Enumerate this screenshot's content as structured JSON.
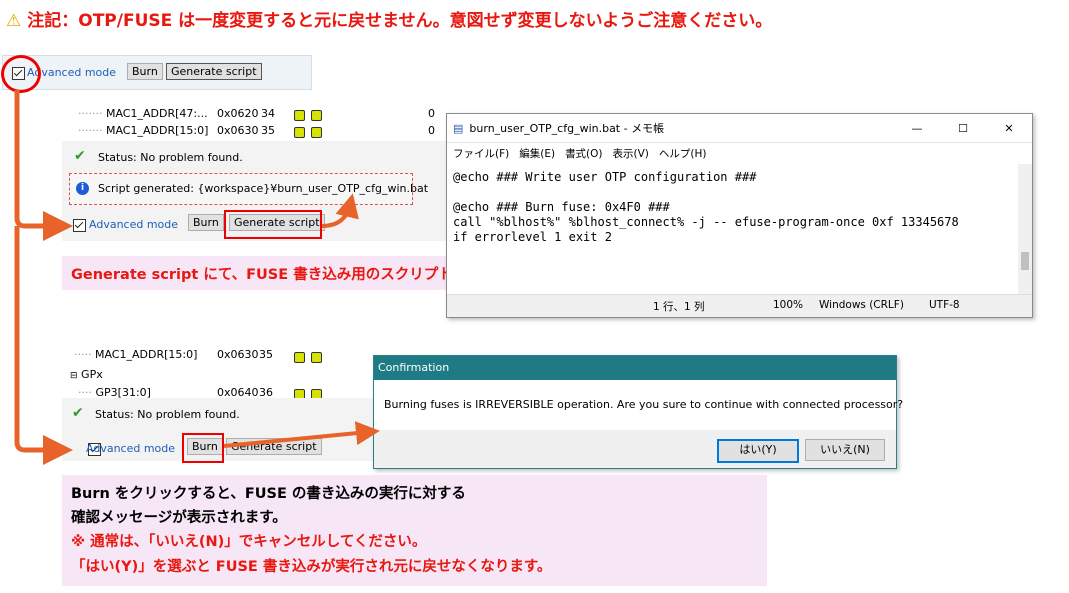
{
  "warning": {
    "icon": "warning-triangle-icon",
    "text": "注記：OTP/FUSE は一度変更すると元に戻せません。意図せず変更しないようご注意ください。"
  },
  "top_toolbar": {
    "advanced_mode": "Advanced mode",
    "burn": "Burn",
    "generate": "Generate script"
  },
  "section1": {
    "rows": [
      {
        "name": "MAC1_ADDR[47:...",
        "addr": "0x0620",
        "idx": "34",
        "val": "0"
      },
      {
        "name": "MAC1_ADDR[15:0]",
        "addr": "0x0630",
        "idx": "35",
        "val": "0"
      }
    ],
    "status": "Status: No problem found.",
    "script_msg": "Script generated: {workspace}¥burn_user_OTP_cfg_win.bat",
    "advanced_mode": "Advanced mode",
    "burn": "Burn",
    "generate": "Generate script",
    "note": "Generate script にて、FUSE 書き込み用のスクリプトが生成されます。"
  },
  "notepad": {
    "title": "burn_user_OTP_cfg_win.bat - メモ帳",
    "menu": [
      "ファイル(F)",
      "編集(E)",
      "書式(O)",
      "表示(V)",
      "ヘルプ(H)"
    ],
    "lines": [
      "@echo ### Write user OTP configuration ###",
      "",
      "@echo ### Burn fuse: 0x4F0 ###",
      "call \"%blhost%\" %blhost_connect% -j -- efuse-program-once 0xf 13345678",
      "if errorlevel 1 exit 2"
    ],
    "status": {
      "pos": "1 行、1 列",
      "zoom": "100%",
      "eol": "Windows (CRLF)",
      "enc": "UTF-8"
    }
  },
  "section2": {
    "rows": [
      {
        "name": "MAC1_ADDR[15:0]",
        "addr": "0x0630",
        "idx": "35"
      },
      {
        "name": "GPx"
      },
      {
        "name": "GP3[31:0]",
        "addr": "0x0640",
        "idx": "36"
      }
    ],
    "status": "Status: No problem found.",
    "advanced_mode": "Advanced mode",
    "burn": "Burn",
    "generate": "Generate script"
  },
  "dialog": {
    "title": "Confirmation",
    "message": "Burning fuses is IRREVERSIBLE operation. Are you sure to continue with connected processor?",
    "yes": "はい(Y)",
    "no": "いいえ(N)"
  },
  "note2": {
    "l1": "Burn をクリックすると、FUSE の書き込みの実行に対する",
    "l2": "確認メッセージが表示されます。",
    "l3": "※ 通常は、「いいえ(N)」でキャンセルしてください。",
    "l4": "「はい(Y)」を選ぶと FUSE 書き込みが実行され元に戻せなくなります。"
  },
  "colors": {
    "accent_red": "#e8170f",
    "arrow": "#e8632a",
    "dialog_title": "#1e7b86",
    "note_bg": "#f6e6f6"
  }
}
